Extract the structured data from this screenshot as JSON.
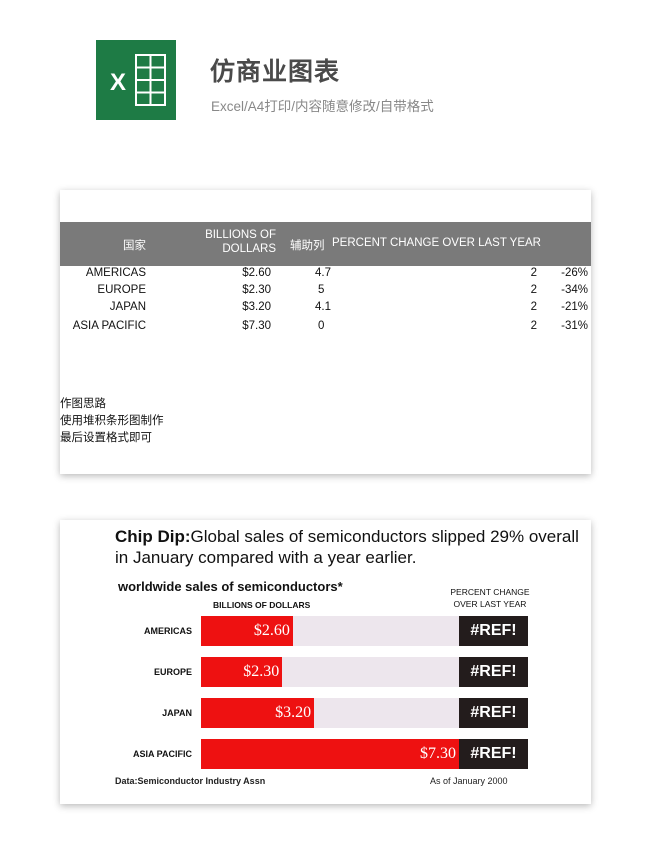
{
  "header": {
    "title": "仿商业图表",
    "subtitle": "Excel/A4打印/内容随意修改/自带格式",
    "logo_letter": "X",
    "logo_color": "#1e7b45"
  },
  "sheet": {
    "columns": {
      "country": "国家",
      "dollars_line1": "BILLIONS OF",
      "dollars_line2": "DOLLARS",
      "aux": "辅助列",
      "pct": "PERCENT CHANGE OVER LAST YEAR"
    },
    "rows": [
      {
        "country": "AMERICAS",
        "dollars": "$2.60",
        "aux": "4.7",
        "pct": "2",
        "change": "-26%"
      },
      {
        "country": "EUROPE",
        "dollars": "$2.30",
        "aux": "5",
        "pct": "2",
        "change": "-34%"
      },
      {
        "country": "JAPAN",
        "dollars": "$3.20",
        "aux": "4.1",
        "pct": "2",
        "change": "-21%"
      },
      {
        "country": "ASIA PACIFIC",
        "dollars": "$7.30",
        "aux": "0",
        "pct": "2",
        "change": "-31%"
      }
    ],
    "notes": [
      "作图思路",
      "使用堆积条形图制作",
      "最后设置格式即可"
    ]
  },
  "chart_data": {
    "type": "bar",
    "title_bold": "Chip Dip:",
    "title": "Global sales of semiconductors slipped 29% overall in January compared with a year earlier.",
    "subtitle": "worldwide  sales of semiconductors*",
    "value_axis_label": "BILLIONS OF DOLLARS",
    "pct_header_line1": "PERCENT CHANGE",
    "pct_header_line2": "OVER LAST YEAR",
    "categories": [
      "AMERICAS",
      "EUROPE",
      "JAPAN",
      "ASIA PACIFIC"
    ],
    "values": [
      2.6,
      2.3,
      3.2,
      7.3
    ],
    "value_labels": [
      "$2.60",
      "$2.30",
      "$3.20",
      "$7.30"
    ],
    "aux_values": [
      4.7,
      5,
      4.1,
      0
    ],
    "pct_labels": [
      "#REF!",
      "#REF!",
      "#REF!",
      "#REF!"
    ],
    "xlim": [
      0,
      7.3
    ],
    "orientation": "horizontal",
    "stacked": true,
    "source": "Data:Semiconductor Industry Assn",
    "date_note": "As of January 2000",
    "colors": {
      "bar": "#ee1111",
      "track": "#ede6ed",
      "ref_box": "#231c1c"
    }
  }
}
